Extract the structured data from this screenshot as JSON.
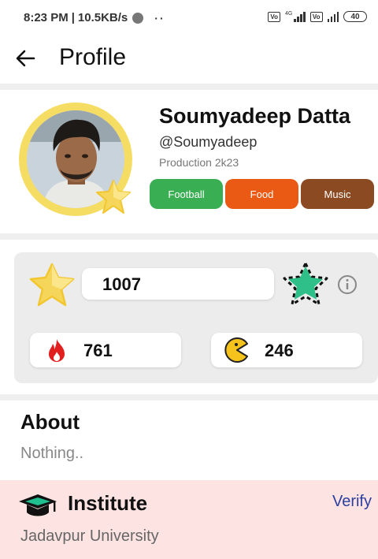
{
  "status_bar": {
    "time": "8:23 PM",
    "separator": "|",
    "speed": "10.5KB/s",
    "dots": "··",
    "network_label": "4G",
    "volte_label": "Vo LTE",
    "battery": "40"
  },
  "header": {
    "back_icon": "arrow-left-icon",
    "title": "Profile"
  },
  "profile": {
    "name": "Soumyadeep Datta",
    "handle": "@Soumyadeep",
    "meta": "Production 2k23",
    "tags": [
      {
        "label": "Football",
        "color": "#3aae53"
      },
      {
        "label": "Food",
        "color": "#ea5a14"
      },
      {
        "label": "Music",
        "color": "#8c4a22"
      }
    ]
  },
  "stats": {
    "stars_value": "1007",
    "streak_value": "761",
    "pacman_value": "246",
    "star_icon": "gold-star-icon",
    "badge_icon": "green-star-badge-icon",
    "info_icon": "info-icon",
    "fire_icon": "fire-icon",
    "pacman_icon": "pacman-icon"
  },
  "about": {
    "title": "About",
    "text": "Nothing.."
  },
  "institute": {
    "icon": "graduation-cap-icon",
    "title": "Institute",
    "verify_label": "Verify",
    "value": "Jadavpur University"
  },
  "colors": {
    "gold": "#f3cf3c",
    "green_badge": "#2fc08a",
    "institute_bg": "#fde4e2",
    "verify": "#2c3fa0"
  }
}
